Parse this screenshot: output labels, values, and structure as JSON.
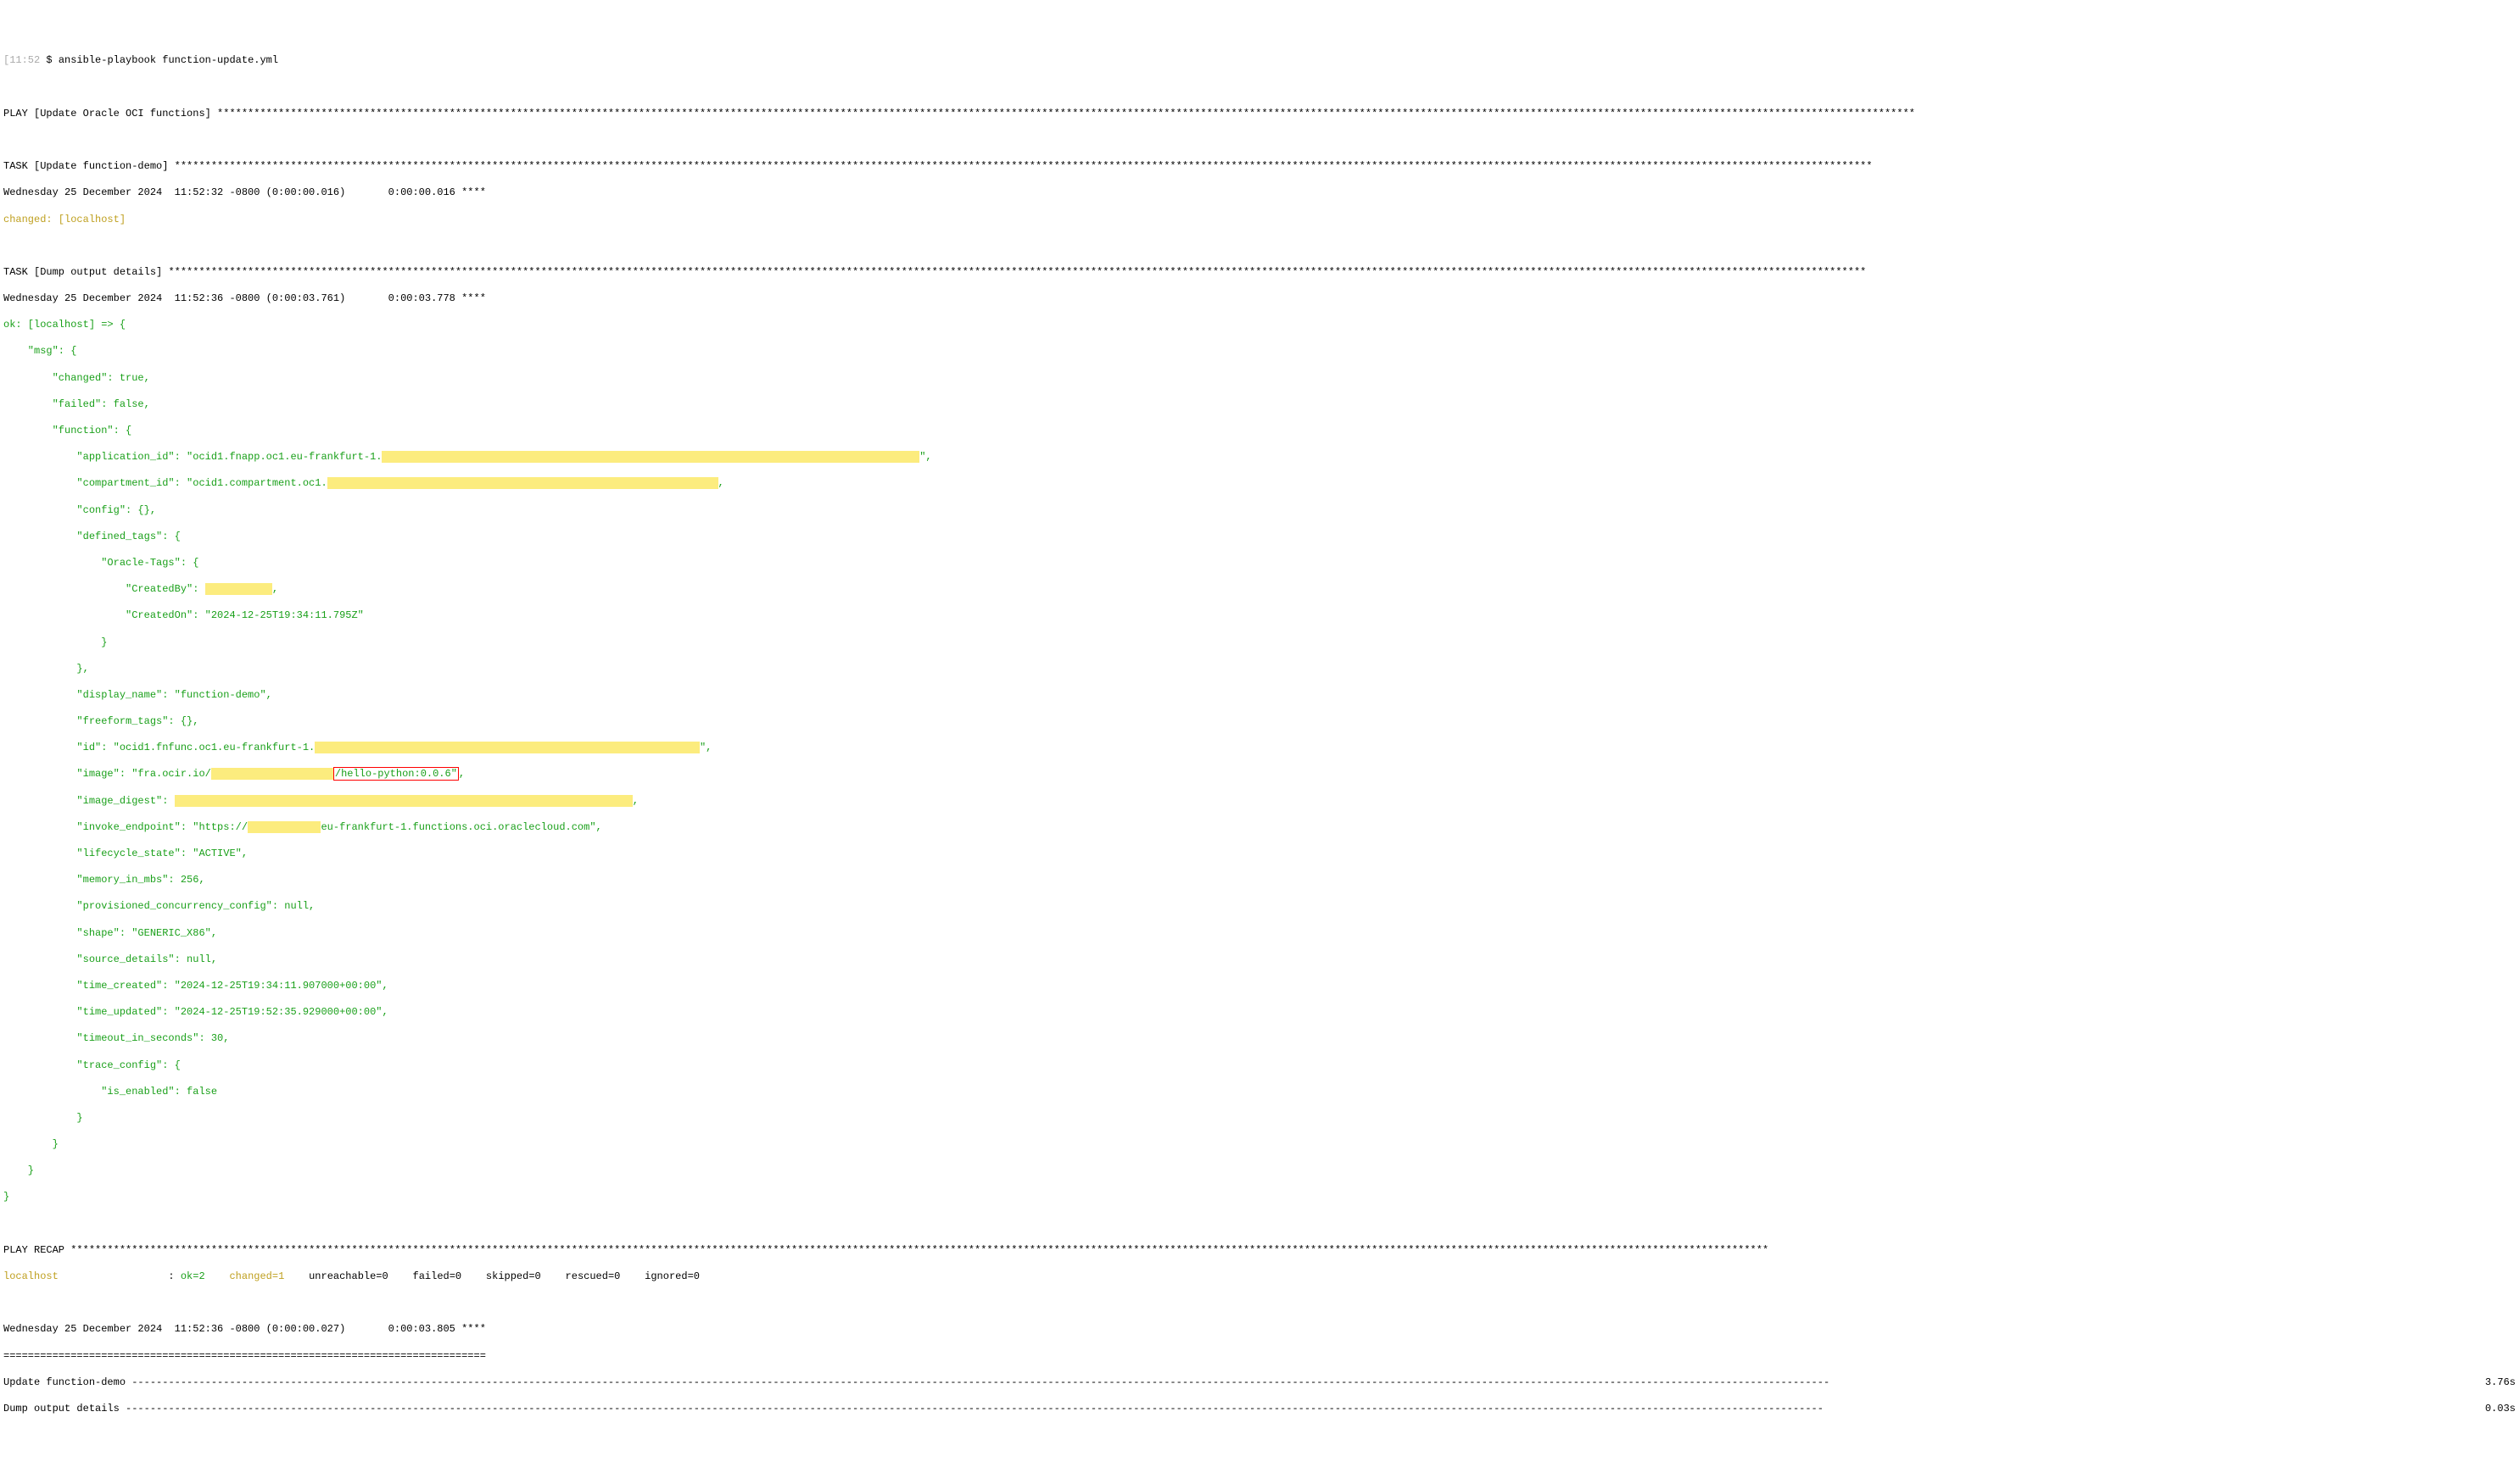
{
  "prompt": {
    "time": "[11:52",
    "sep": " $ ",
    "command": "ansible-playbook function-update.yml"
  },
  "play_header": "PLAY [Update Oracle OCI functions] ",
  "task1": {
    "header": "TASK [Update function-demo] ",
    "timestamp": "Wednesday 25 December 2024  11:52:32 -0800 (0:00:00.016)       0:00:00.016 ****",
    "status": "changed: [localhost]"
  },
  "task2": {
    "header": "TASK [Dump output details] ",
    "timestamp": "Wednesday 25 December 2024  11:52:36 -0800 (0:00:03.761)       0:00:03.778 ****",
    "ok_line": "ok: [localhost] => {"
  },
  "msg": {
    "msg_open": "    \"msg\": {",
    "changed": "        \"changed\": true,",
    "failed": "        \"failed\": false,",
    "function_open": "        \"function\": {",
    "app_id_key": "            \"application_id\": \"ocid1.fnapp.oc1.eu-frankfurt-1.",
    "app_id_end": "\",",
    "compartment_id_key": "            \"compartment_id\": \"ocid1.compartment.oc1.",
    "compartment_id_end": ",",
    "config": "            \"config\": {},",
    "defined_tags_open": "            \"defined_tags\": {",
    "oracle_tags_open": "                \"Oracle-Tags\": {",
    "created_by_key": "                    \"CreatedBy\": ",
    "created_by_end": ",",
    "created_on": "                    \"CreatedOn\": \"2024-12-25T19:34:11.795Z\"",
    "oracle_tags_close": "                }",
    "defined_tags_close": "            },",
    "display_name": "            \"display_name\": \"function-demo\",",
    "freeform_tags": "            \"freeform_tags\": {},",
    "id_key": "            \"id\": \"ocid1.fnfunc.oc1.eu-frankfurt-1.",
    "id_end": "\",",
    "image_key": "            \"image\": \"fra.ocir.io/",
    "image_box": "/hello-python:0.0.6\"",
    "image_end": ",",
    "image_digest_key": "            \"image_digest\": ",
    "image_digest_end": ",",
    "invoke_key": "            \"invoke_endpoint\": \"https://",
    "invoke_end": "eu-frankfurt-1.functions.oci.oraclecloud.com\",",
    "lifecycle": "            \"lifecycle_state\": \"ACTIVE\",",
    "memory": "            \"memory_in_mbs\": 256,",
    "pcc": "            \"provisioned_concurrency_config\": null,",
    "shape": "            \"shape\": \"GENERIC_X86\",",
    "source_details": "            \"source_details\": null,",
    "time_created": "            \"time_created\": \"2024-12-25T19:34:11.907000+00:00\",",
    "time_updated": "            \"time_updated\": \"2024-12-25T19:52:35.929000+00:00\",",
    "timeout": "            \"timeout_in_seconds\": 30,",
    "trace_open": "            \"trace_config\": {",
    "is_enabled": "                \"is_enabled\": false",
    "trace_close": "            }",
    "function_close": "        }",
    "msg_close": "    }",
    "root_close": "}"
  },
  "recap": {
    "header": "PLAY RECAP ",
    "host": "localhost",
    "sep": "                  : ",
    "ok": "ok=2   ",
    "changed": "changed=1   ",
    "rest": "unreachable=0    failed=0    skipped=0    rescued=0    ignored=0"
  },
  "footer": {
    "timestamp": "Wednesday 25 December 2024  11:52:36 -0800 (0:00:00.027)       0:00:03.805 ****",
    "sep": "===============================================================================",
    "task1_name": "Update function-demo ",
    "task1_time": " 3.76s",
    "task2_name": "Dump output details ",
    "task2_time": " 0.03s"
  },
  "star_fill": "**************************************************************************************************************************************************************************************************************************************************************************************",
  "dash_fill": "--------------------------------------------------------------------------------------------------------------------------------------------------------------------------------------------------------------------------------------------------------------------------------------"
}
